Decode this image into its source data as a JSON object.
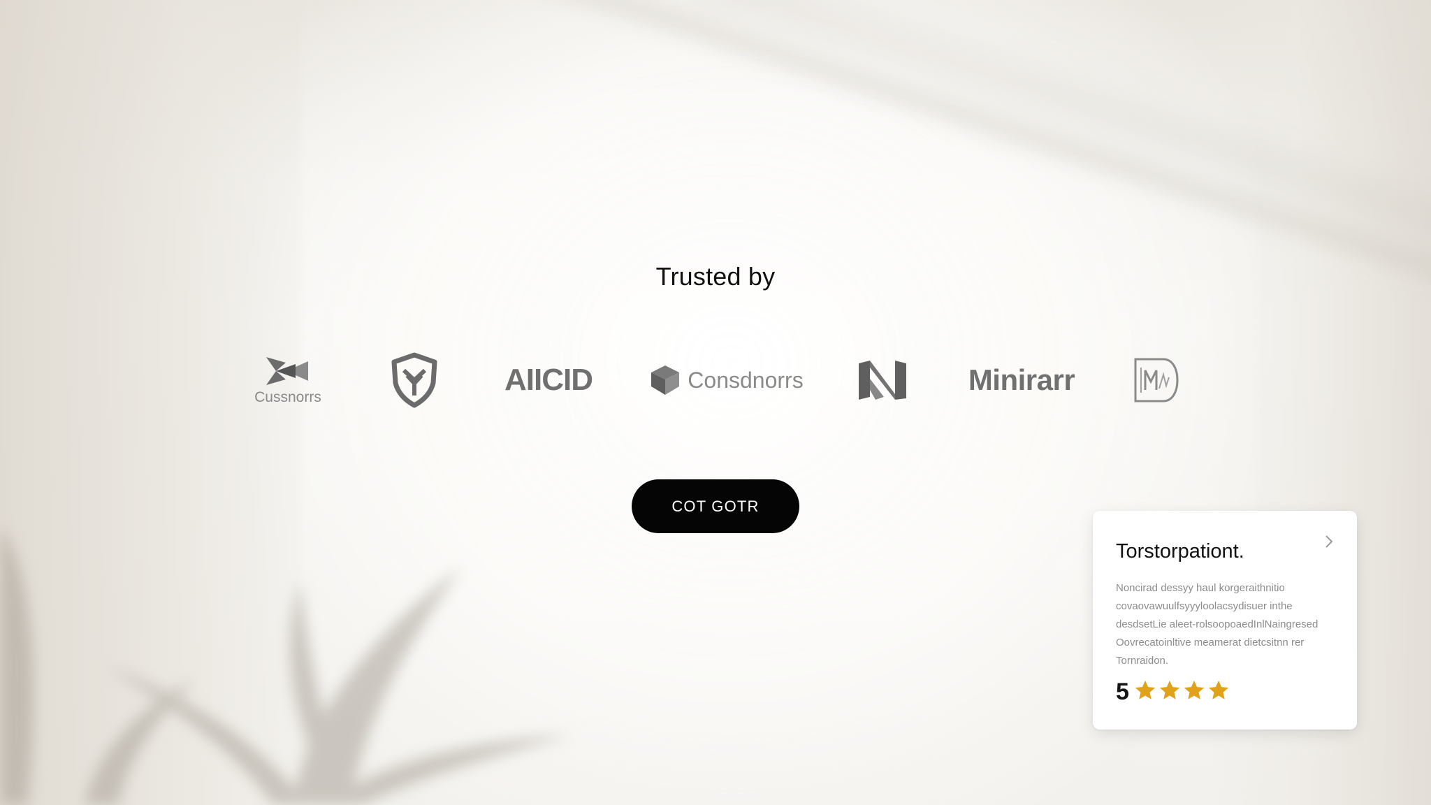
{
  "section": {
    "title": "Trusted by"
  },
  "logos": [
    {
      "name": "Cussnorrs",
      "icon": "bow-tie-mark-icon"
    },
    {
      "name": "",
      "icon": "shield-icon"
    },
    {
      "name": "AIICID",
      "icon": ""
    },
    {
      "name": "Consdnorrs",
      "icon": "cube-icon"
    },
    {
      "name": "",
      "icon": "n-monogram-icon"
    },
    {
      "name": "Minirarr",
      "icon": ""
    },
    {
      "name": "",
      "icon": "m-badge-icon"
    }
  ],
  "cta": {
    "label": "COT GOTR"
  },
  "testimonial": {
    "title": "Torstorpationt.",
    "body_lines": [
      "Noncirad dessyy haul korgeraithnitio",
      "covaovawuulfsyyyloolacsydisuer inthe",
      "desdsetLie aleet-rolsoopoaedInlNaingresed",
      "Oovrecatoinltive meamerat dietcsitnn rer",
      "Tornraidon."
    ],
    "rating_value": "5",
    "stars": 4,
    "star_color": "#e0a11b",
    "chevron_icon": "chevron-right-icon"
  },
  "colors": {
    "button_bg": "#050505",
    "logo_gray": "#707070",
    "background": "#f3f1ed"
  }
}
